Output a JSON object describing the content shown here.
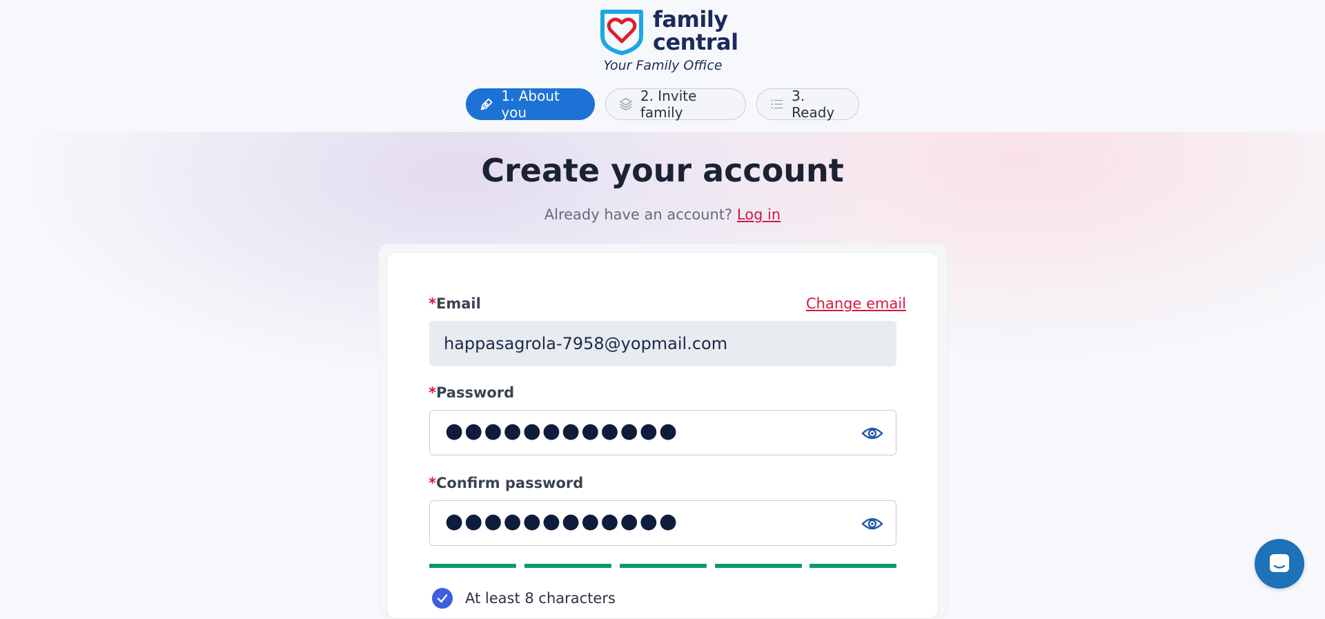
{
  "brand": {
    "line1": "family",
    "line2": "central",
    "tagline": "Your Family Office"
  },
  "steps": [
    {
      "label": "1. About you",
      "icon": "pen-icon",
      "active": true
    },
    {
      "label": "2. Invite family",
      "icon": "layers-icon",
      "active": false
    },
    {
      "label": "3. Ready",
      "icon": "list-icon",
      "active": false
    }
  ],
  "page": {
    "title": "Create your account",
    "subtitle": "Already have an account?",
    "login_link": "Log in"
  },
  "form": {
    "email_label": "Email",
    "change_email": "Change email",
    "email_value": "happasagrola-7958@yopmail.com",
    "password_label": "Password",
    "password_value": "●●●●●●●●●●●●",
    "confirm_label": "Confirm password",
    "confirm_value": "●●●●●●●●●●●●",
    "required_marker": "*",
    "strength_segments_filled": 5,
    "strength_segments_total": 5,
    "requirement_1": "At least 8 characters"
  },
  "colors": {
    "accent": "#1d72d6",
    "link": "#d7163f",
    "strength": "#0f9a6a",
    "brand_navy": "#1a2a5e"
  }
}
